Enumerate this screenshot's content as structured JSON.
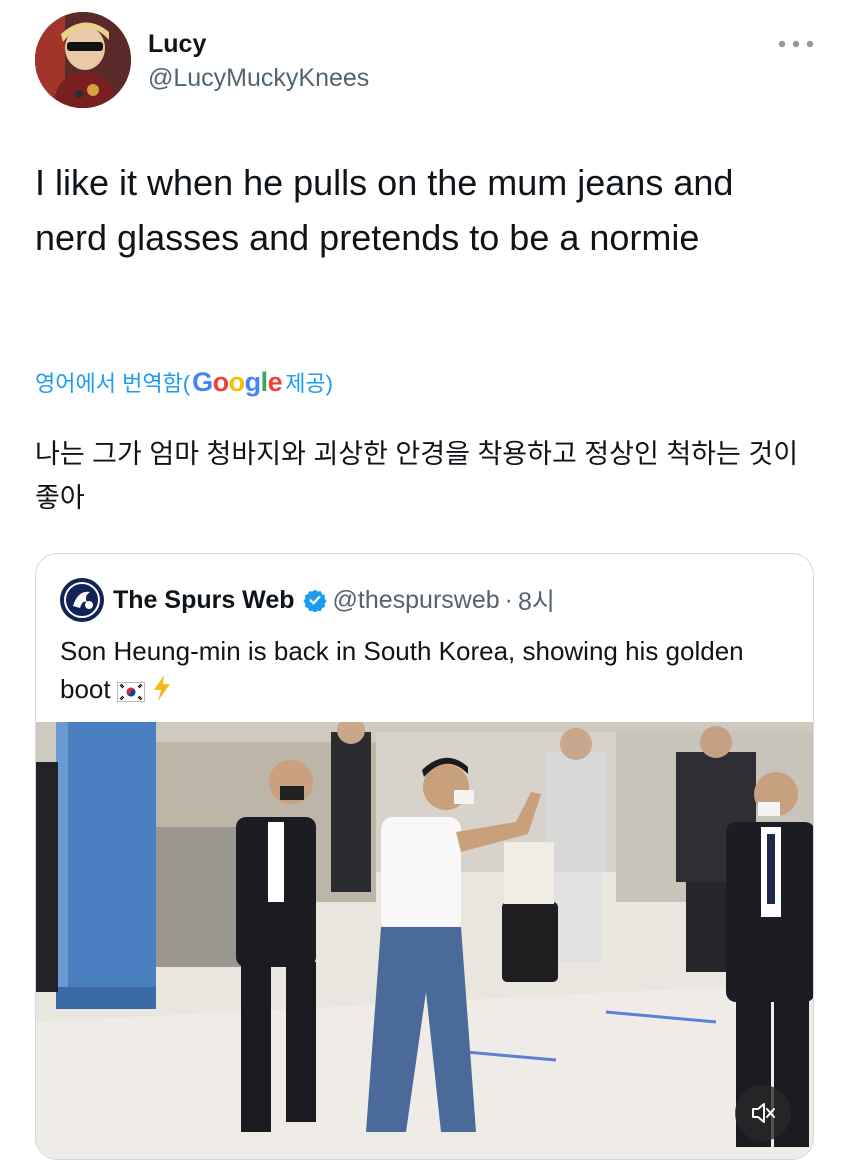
{
  "tweet": {
    "author_name": "Lucy",
    "author_handle": "@LucyMuckyKnees",
    "text": "I like it when he pulls on the mum jeans and nerd glasses and pretends to be a normie",
    "translation": {
      "prefix": "영어에서 번역함(",
      "provider": "Google",
      "suffix": " 제공)",
      "text": "나는 그가 엄마 청바지와 괴상한 안경을 착용하고 정상인 척하는 것이 좋아"
    }
  },
  "quoted_tweet": {
    "author_name": "The Spurs Web",
    "author_handle": "@thespursweb",
    "separator": "·",
    "time": "8시",
    "text": "Son Heung-min is back in South Korea, showing his golden boot"
  },
  "icons": {
    "more": "more-horizontal-icon",
    "verified": "verified-badge-icon",
    "flag": "south-korea-flag-icon",
    "bolt": "lightning-bolt-icon",
    "mute": "speaker-muted-icon"
  },
  "colors": {
    "link_blue": "#1d9bf0",
    "text_primary": "#0f1419",
    "text_secondary": "#536471",
    "border": "#cfd9de",
    "bolt_yellow": "#f5b81f"
  }
}
